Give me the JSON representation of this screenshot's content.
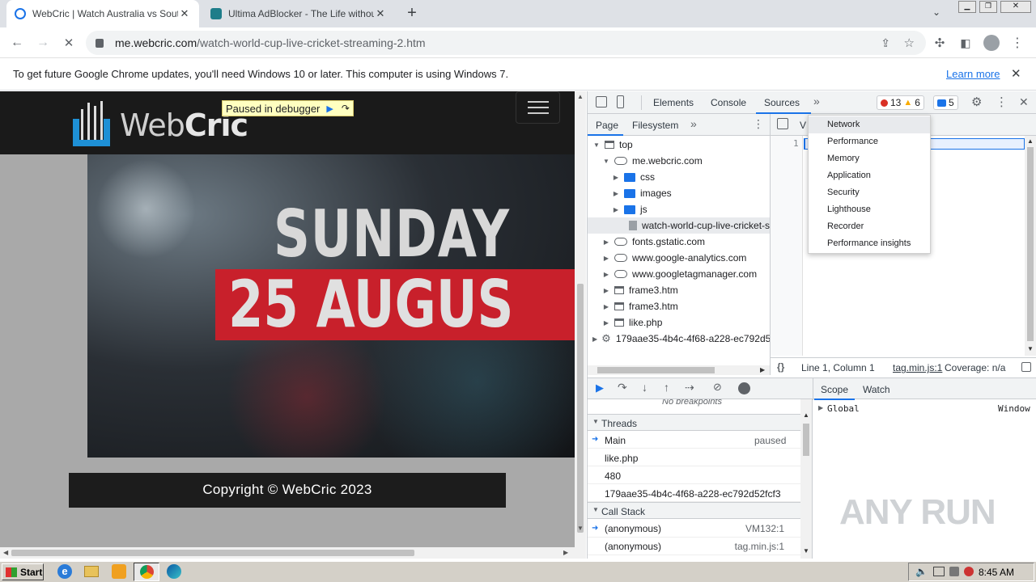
{
  "browser": {
    "tabs": [
      {
        "title": "WebCric | Watch Australia vs South",
        "active": true
      },
      {
        "title": "Ultima AdBlocker - The Life without A",
        "active": false
      }
    ],
    "url_domain": "me.webcric.com",
    "url_path": "/watch-world-cup-live-cricket-streaming-2.htm",
    "infobar_text": "To get future Google Chrome updates, you'll need Windows 10 or later. This computer is using Windows 7.",
    "infobar_link": "Learn more"
  },
  "page": {
    "logo_text_a": "Web",
    "logo_text_b": "Cric",
    "debugger_badge": "Paused in debugger",
    "hero_line1": "SUNDAY",
    "hero_line2": "25 AUGUS",
    "footer_text": "Copyright © WebCric 2023"
  },
  "devtools": {
    "tabs": [
      "Elements",
      "Console",
      "Sources"
    ],
    "active_tab": "Sources",
    "errors": "13",
    "warnings": "6",
    "messages": "5",
    "nav_tabs": [
      "Page",
      "Filesystem"
    ],
    "tree": [
      {
        "label": "top",
        "indent": 0,
        "icon": "frame",
        "tri": "down"
      },
      {
        "label": "me.webcric.com",
        "indent": 1,
        "icon": "cloud",
        "tri": "down"
      },
      {
        "label": "css",
        "indent": 2,
        "icon": "folder",
        "tri": "right"
      },
      {
        "label": "images",
        "indent": 2,
        "icon": "folder",
        "tri": "right"
      },
      {
        "label": "js",
        "indent": 2,
        "icon": "folder",
        "tri": "right"
      },
      {
        "label": "watch-world-cup-live-cricket-st",
        "indent": 3,
        "icon": "file",
        "tri": ""
      },
      {
        "label": "fonts.gstatic.com",
        "indent": 1,
        "icon": "cloud",
        "tri": "right"
      },
      {
        "label": "www.google-analytics.com",
        "indent": 1,
        "icon": "cloud",
        "tri": "right"
      },
      {
        "label": "www.googletagmanager.com",
        "indent": 1,
        "icon": "cloud",
        "tri": "right"
      },
      {
        "label": "frame3.htm",
        "indent": 1,
        "icon": "frame",
        "tri": "right"
      },
      {
        "label": "frame3.htm",
        "indent": 1,
        "icon": "frame",
        "tri": "right"
      },
      {
        "label": "like.php",
        "indent": 1,
        "icon": "frame",
        "tri": "right"
      },
      {
        "label": "179aae35-4b4c-4f68-a228-ec792d5",
        "indent": 0,
        "icon": "gear",
        "tri": "right"
      }
    ],
    "overflow_menu": [
      "Network",
      "Performance",
      "Memory",
      "Application",
      "Security",
      "Lighthouse",
      "Recorder",
      "Performance insights"
    ],
    "editor_line_number": "1",
    "editor_tab_char": "V",
    "status_position": "Line 1, Column 1",
    "status_file": "tag.min.js:1",
    "status_coverage": "Coverage: n/a",
    "no_breakpoints": "No breakpoints",
    "threads_header": "Threads",
    "threads": [
      {
        "name": "Main",
        "status": "paused",
        "current": true
      },
      {
        "name": "like.php",
        "status": "",
        "current": false
      },
      {
        "name": "480",
        "status": "",
        "current": false
      },
      {
        "name": "179aae35-4b4c-4f68-a228-ec792d52fcf3",
        "status": "",
        "current": false
      }
    ],
    "callstack_header": "Call Stack",
    "callstack": [
      {
        "fn": "(anonymous)",
        "loc": "VM132:1",
        "current": true
      },
      {
        "fn": "(anonymous)",
        "loc": "tag.min.js:1",
        "current": false
      }
    ],
    "scope_tabs": [
      "Scope",
      "Watch"
    ],
    "scope_global": "Global",
    "scope_global_value": "Window"
  },
  "taskbar": {
    "start_label": "Start",
    "clock": "8:45 AM"
  },
  "watermark": "ANY RUN",
  "colors": {
    "accent": "#1a73e8",
    "debugger_badge_bg": "#ffffc0",
    "hero_banner_red": "#c8202b",
    "logo_blue": "#1e90d6"
  }
}
